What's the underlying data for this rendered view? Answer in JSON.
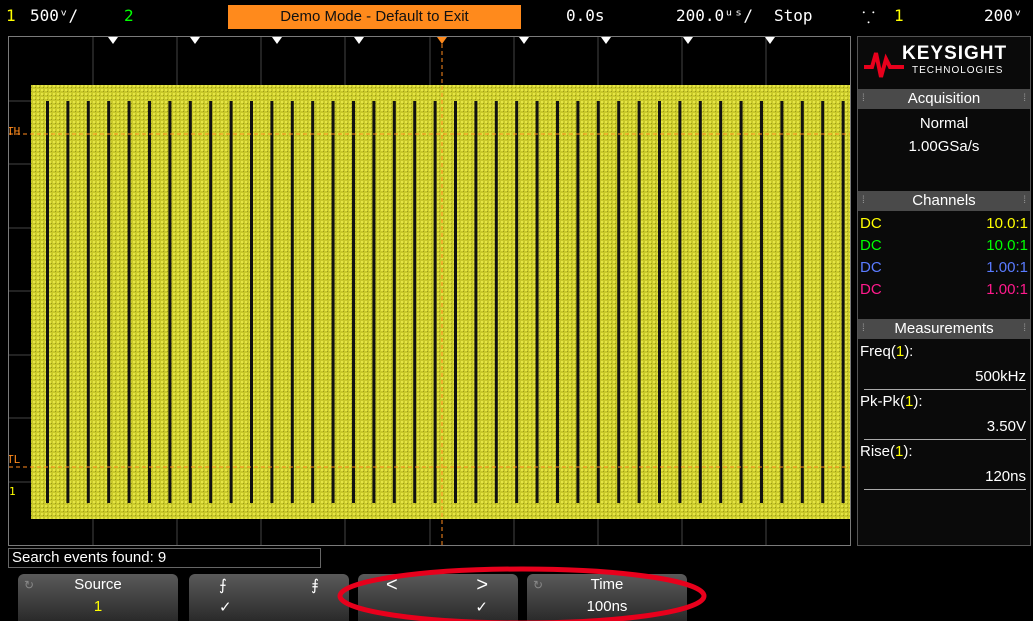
{
  "topbar": {
    "ch1_num": "1",
    "ch1_scale": "500ᵛ/",
    "ch2_num": "2",
    "demo": "Demo Mode - Default to Exit",
    "delay": "0.0s",
    "timebase": "200.0ᵘˢ/",
    "status": "Stop",
    "trig_icon": "⸪",
    "trig_src": "1",
    "trig_level": "200ᵛ"
  },
  "panel": {
    "brand": "KEYSIGHT",
    "brand_sub": "TECHNOLOGIES",
    "acq_title": "Acquisition",
    "acq_mode": "Normal",
    "acq_rate": "1.00GSa/s",
    "ch_title": "Channels",
    "channels": [
      {
        "coupling": "DC",
        "probe": "10.0:1",
        "color": "#ffff00"
      },
      {
        "coupling": "DC",
        "probe": "10.0:1",
        "color": "#00ff00"
      },
      {
        "coupling": "DC",
        "probe": "1.00:1",
        "color": "#5a7bff"
      },
      {
        "coupling": "DC",
        "probe": "1.00:1",
        "color": "#ff1a8c"
      }
    ],
    "meas_title": "Measurements",
    "meas": [
      {
        "name": "Freq",
        "src": "1",
        "value": "500kHz"
      },
      {
        "name": "Pk-Pk",
        "src": "1",
        "value": "3.50V"
      },
      {
        "name": "Rise",
        "src": "1",
        "value": "120ns"
      }
    ]
  },
  "markers": {
    "th": "TH",
    "tl": "TL",
    "gnd": "1"
  },
  "search": "Search events found: 9",
  "softkeys": {
    "source_label": "Source",
    "source_value": "1",
    "rise_sym": "⨍",
    "fall_sym": "⨎",
    "check": "✓",
    "prev": "<",
    "next": ">",
    "time_label": "Time",
    "time_value": "100ns"
  },
  "colors": {
    "ch1": "#ffff00",
    "accent": "#ff8a1c",
    "highlight": "#e8001c"
  }
}
